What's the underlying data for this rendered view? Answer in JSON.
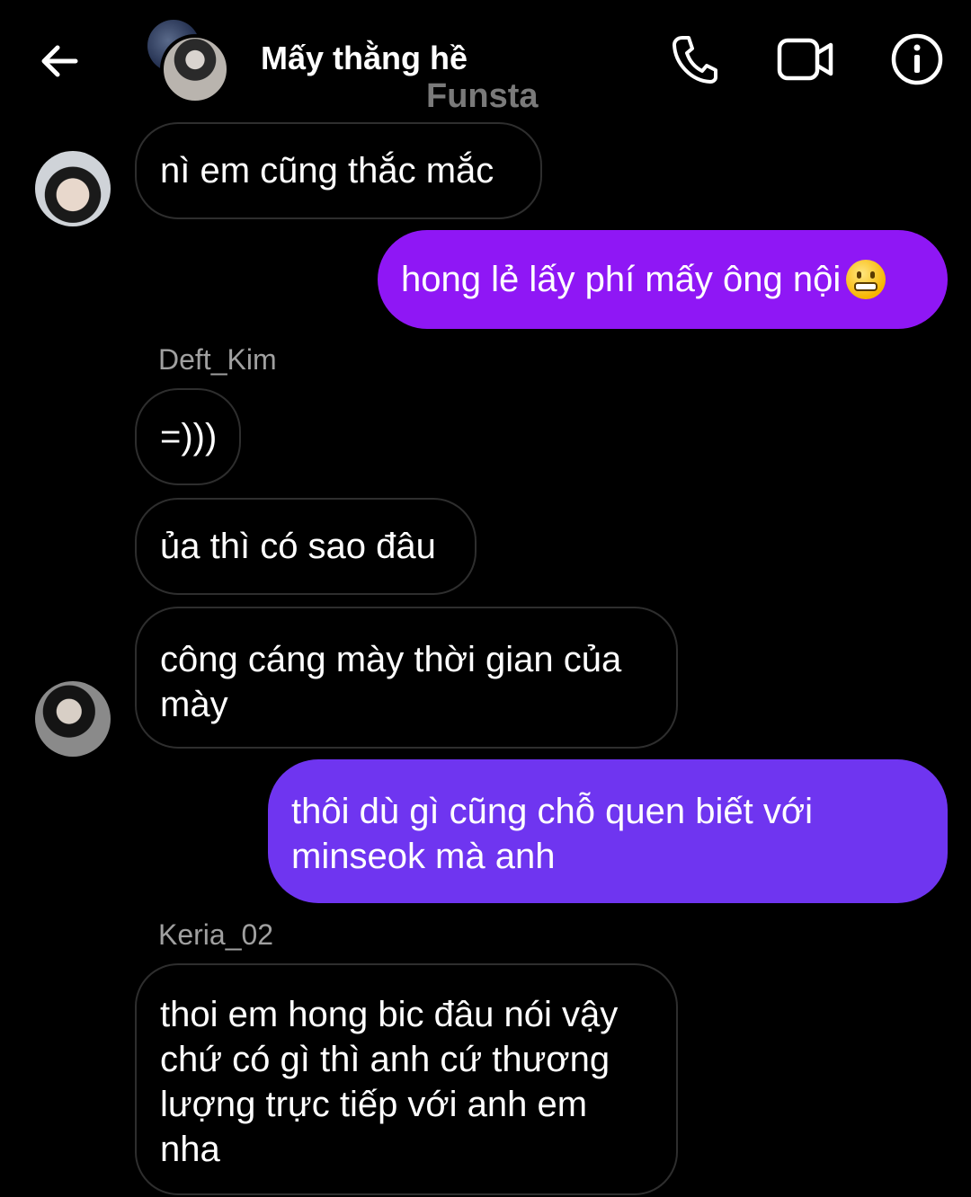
{
  "header": {
    "title": "Mấy thằng hề",
    "watermark": "Funsta",
    "back_icon": "arrow-left-icon",
    "call_icon": "phone-icon",
    "video_icon": "video-camera-icon",
    "info_icon": "info-icon"
  },
  "colors": {
    "background": "#000000",
    "incoming_border": "#2e2e2e",
    "outgoing_1": "#8f17f5",
    "outgoing_2": "#6f35f0",
    "sender_name": "#a0a0a0"
  },
  "messages": [
    {
      "from": "other",
      "text": "nì em cũng thắc mắc"
    },
    {
      "from": "me",
      "text": "hong lẻ lấy phí mấy ông nội",
      "emoji": "grimacing-face-emoji"
    },
    {
      "sender": "Deft_Kim"
    },
    {
      "from": "other",
      "text": "=)))"
    },
    {
      "from": "other",
      "text": "ủa thì có sao đâu"
    },
    {
      "from": "other",
      "lines": [
        "công cáng mày thời gian của",
        "mày"
      ]
    },
    {
      "from": "me",
      "lines": [
        "thôi dù gì cũng chỗ quen biết với",
        "minseok mà anh"
      ]
    },
    {
      "sender": "Keria_02"
    },
    {
      "from": "other",
      "lines": [
        "thoi em hong bic đâu nói vậy",
        "chứ có gì thì anh cứ thương",
        "lượng trực tiếp với anh em",
        "nha"
      ]
    }
  ]
}
